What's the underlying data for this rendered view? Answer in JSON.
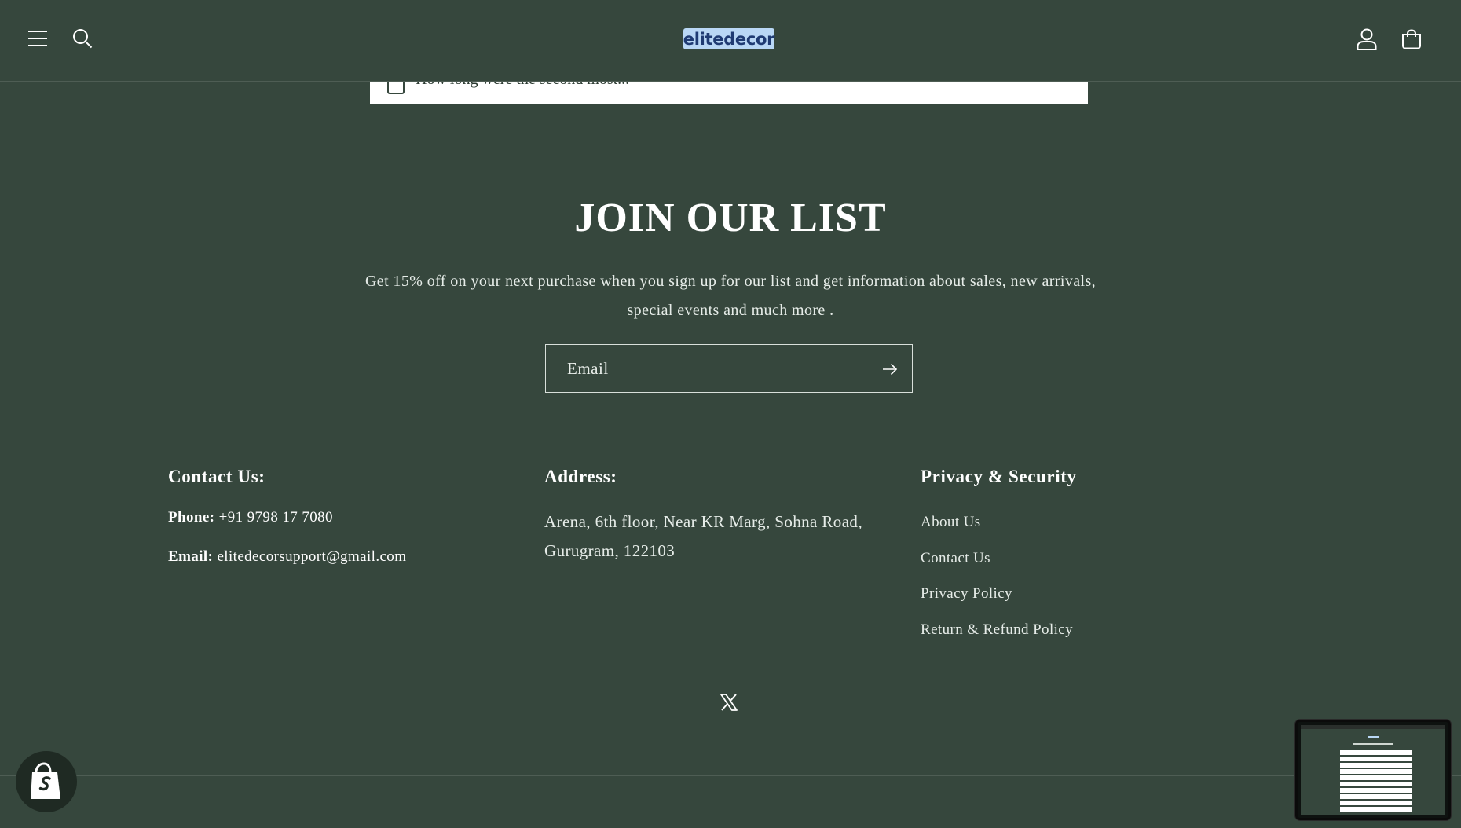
{
  "header": {
    "logo_text": "elitedecor"
  },
  "faq_partial": {
    "question": "How long were the second most..."
  },
  "newsletter": {
    "title": "JOIN OUR LIST",
    "description": "Get 15% off on your next purchase when you sign up for our list and get information about sales, new arrivals, special events and much more .",
    "email_placeholder": "Email"
  },
  "footer": {
    "contact": {
      "heading": "Contact Us:",
      "phone_label": "Phone:",
      "phone_value": "+91 9798 17 7080",
      "email_label": "Email:",
      "email_value": "elitedecorsupport@gmail.com"
    },
    "address": {
      "heading": "Address:",
      "text": "Arena, 6th floor, Near KR Marg, Sohna Road, Gurugram, 122103"
    },
    "links": {
      "heading": "Privacy & Security",
      "items": [
        "About Us",
        "Contact Us",
        "Privacy Policy",
        "Return & Refund Policy"
      ]
    }
  },
  "icons": {
    "menu": "hamburger-menu-icon",
    "search": "search-icon",
    "account": "user-icon",
    "cart": "cart-icon",
    "submit": "arrow-right-icon",
    "social": "x-twitter-icon",
    "badge": "shopify-bag-icon"
  },
  "colors": {
    "background": "#36473d",
    "logo_bg": "#b9d7f5",
    "logo_text": "#1f3b73",
    "text": "#ffffff"
  }
}
